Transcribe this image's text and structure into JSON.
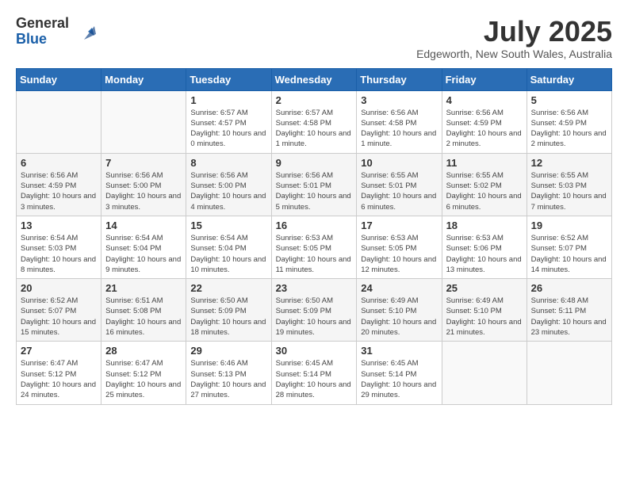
{
  "header": {
    "logo_general": "General",
    "logo_blue": "Blue",
    "month_year": "July 2025",
    "location": "Edgeworth, New South Wales, Australia"
  },
  "days_of_week": [
    "Sunday",
    "Monday",
    "Tuesday",
    "Wednesday",
    "Thursday",
    "Friday",
    "Saturday"
  ],
  "weeks": [
    [
      {
        "day": "",
        "info": ""
      },
      {
        "day": "",
        "info": ""
      },
      {
        "day": "1",
        "info": "Sunrise: 6:57 AM\nSunset: 4:57 PM\nDaylight: 10 hours and 0 minutes."
      },
      {
        "day": "2",
        "info": "Sunrise: 6:57 AM\nSunset: 4:58 PM\nDaylight: 10 hours and 1 minute."
      },
      {
        "day": "3",
        "info": "Sunrise: 6:56 AM\nSunset: 4:58 PM\nDaylight: 10 hours and 1 minute."
      },
      {
        "day": "4",
        "info": "Sunrise: 6:56 AM\nSunset: 4:59 PM\nDaylight: 10 hours and 2 minutes."
      },
      {
        "day": "5",
        "info": "Sunrise: 6:56 AM\nSunset: 4:59 PM\nDaylight: 10 hours and 2 minutes."
      }
    ],
    [
      {
        "day": "6",
        "info": "Sunrise: 6:56 AM\nSunset: 4:59 PM\nDaylight: 10 hours and 3 minutes."
      },
      {
        "day": "7",
        "info": "Sunrise: 6:56 AM\nSunset: 5:00 PM\nDaylight: 10 hours and 3 minutes."
      },
      {
        "day": "8",
        "info": "Sunrise: 6:56 AM\nSunset: 5:00 PM\nDaylight: 10 hours and 4 minutes."
      },
      {
        "day": "9",
        "info": "Sunrise: 6:56 AM\nSunset: 5:01 PM\nDaylight: 10 hours and 5 minutes."
      },
      {
        "day": "10",
        "info": "Sunrise: 6:55 AM\nSunset: 5:01 PM\nDaylight: 10 hours and 6 minutes."
      },
      {
        "day": "11",
        "info": "Sunrise: 6:55 AM\nSunset: 5:02 PM\nDaylight: 10 hours and 6 minutes."
      },
      {
        "day": "12",
        "info": "Sunrise: 6:55 AM\nSunset: 5:03 PM\nDaylight: 10 hours and 7 minutes."
      }
    ],
    [
      {
        "day": "13",
        "info": "Sunrise: 6:54 AM\nSunset: 5:03 PM\nDaylight: 10 hours and 8 minutes."
      },
      {
        "day": "14",
        "info": "Sunrise: 6:54 AM\nSunset: 5:04 PM\nDaylight: 10 hours and 9 minutes."
      },
      {
        "day": "15",
        "info": "Sunrise: 6:54 AM\nSunset: 5:04 PM\nDaylight: 10 hours and 10 minutes."
      },
      {
        "day": "16",
        "info": "Sunrise: 6:53 AM\nSunset: 5:05 PM\nDaylight: 10 hours and 11 minutes."
      },
      {
        "day": "17",
        "info": "Sunrise: 6:53 AM\nSunset: 5:05 PM\nDaylight: 10 hours and 12 minutes."
      },
      {
        "day": "18",
        "info": "Sunrise: 6:53 AM\nSunset: 5:06 PM\nDaylight: 10 hours and 13 minutes."
      },
      {
        "day": "19",
        "info": "Sunrise: 6:52 AM\nSunset: 5:07 PM\nDaylight: 10 hours and 14 minutes."
      }
    ],
    [
      {
        "day": "20",
        "info": "Sunrise: 6:52 AM\nSunset: 5:07 PM\nDaylight: 10 hours and 15 minutes."
      },
      {
        "day": "21",
        "info": "Sunrise: 6:51 AM\nSunset: 5:08 PM\nDaylight: 10 hours and 16 minutes."
      },
      {
        "day": "22",
        "info": "Sunrise: 6:50 AM\nSunset: 5:09 PM\nDaylight: 10 hours and 18 minutes."
      },
      {
        "day": "23",
        "info": "Sunrise: 6:50 AM\nSunset: 5:09 PM\nDaylight: 10 hours and 19 minutes."
      },
      {
        "day": "24",
        "info": "Sunrise: 6:49 AM\nSunset: 5:10 PM\nDaylight: 10 hours and 20 minutes."
      },
      {
        "day": "25",
        "info": "Sunrise: 6:49 AM\nSunset: 5:10 PM\nDaylight: 10 hours and 21 minutes."
      },
      {
        "day": "26",
        "info": "Sunrise: 6:48 AM\nSunset: 5:11 PM\nDaylight: 10 hours and 23 minutes."
      }
    ],
    [
      {
        "day": "27",
        "info": "Sunrise: 6:47 AM\nSunset: 5:12 PM\nDaylight: 10 hours and 24 minutes."
      },
      {
        "day": "28",
        "info": "Sunrise: 6:47 AM\nSunset: 5:12 PM\nDaylight: 10 hours and 25 minutes."
      },
      {
        "day": "29",
        "info": "Sunrise: 6:46 AM\nSunset: 5:13 PM\nDaylight: 10 hours and 27 minutes."
      },
      {
        "day": "30",
        "info": "Sunrise: 6:45 AM\nSunset: 5:14 PM\nDaylight: 10 hours and 28 minutes."
      },
      {
        "day": "31",
        "info": "Sunrise: 6:45 AM\nSunset: 5:14 PM\nDaylight: 10 hours and 29 minutes."
      },
      {
        "day": "",
        "info": ""
      },
      {
        "day": "",
        "info": ""
      }
    ]
  ]
}
